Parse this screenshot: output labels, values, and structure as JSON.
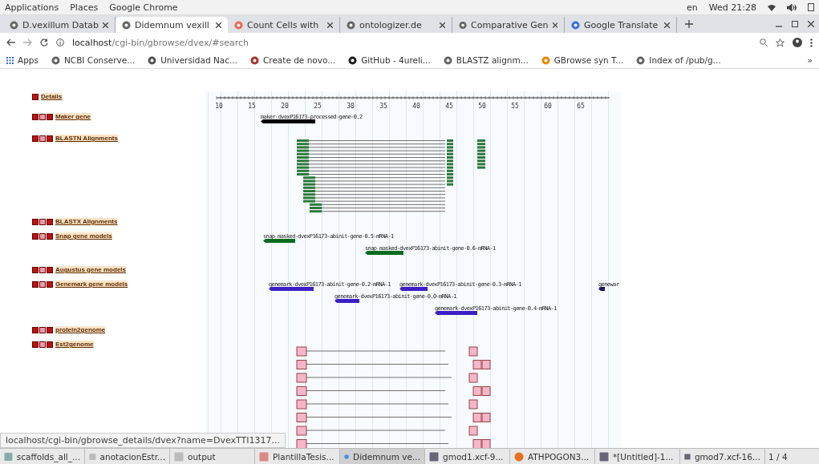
{
  "top_bar": {
    "menus": [
      "Applications",
      "Places",
      "Google Chrome"
    ],
    "language": "en",
    "clock": "Wed 21:28"
  },
  "tabs": [
    {
      "label": "D.vexillum Datab",
      "selected": false
    },
    {
      "label": "Didemnum vexill",
      "selected": true
    },
    {
      "label": "Count Cells with",
      "selected": false
    },
    {
      "label": "ontologizer.de",
      "selected": false
    },
    {
      "label": "Comparative Gen",
      "selected": false
    },
    {
      "label": "Google Translate",
      "selected": false
    }
  ],
  "address_bar": {
    "host": "localhost",
    "path": "/cgi-bin/gbrowse/dvex/#search"
  },
  "bookmarks": [
    "Apps",
    "NCBI Conserve...",
    "Universidad Nac...",
    "Create de novo...",
    "GitHub - 4ureli...",
    "BLASTZ alignm...",
    "GBrowse syn T...",
    "Index of /pub/g..."
  ],
  "bookmarks_more": "»",
  "ruler_ticks": [
    "10",
    "15",
    "20",
    "25",
    "30",
    "35",
    "40",
    "45",
    "50",
    "55",
    "60",
    "65"
  ],
  "tracks": [
    {
      "label": "Details",
      "kind": "ruler"
    },
    {
      "label": "Maker gene",
      "kind": "genes",
      "features": [
        {
          "label": "maker-dvexP16173-processed-gene-0.2",
          "color": "#000000"
        }
      ]
    },
    {
      "label": "BLASTN Alignments",
      "kind": "alignments"
    },
    {
      "label": "BLASTX Alignments",
      "kind": "empty"
    },
    {
      "label": "Snap gene models",
      "kind": "genes",
      "features": [
        {
          "label": "snap_masked-dvexP16173-abinit-gene-0.5-mRNA-1",
          "color": "#0b6b1e"
        },
        {
          "label": "snap_masked-dvexP16173-abinit-gene-0.6-mRNA-1",
          "color": "#0b6b1e"
        }
      ]
    },
    {
      "label": "Augustus gene models",
      "kind": "empty"
    },
    {
      "label": "Genemark gene models",
      "kind": "genes",
      "features": [
        {
          "label": "genemark-dvexP16173-abinit-gene-0.2-mRNA-1",
          "color": "#3b1fc4"
        },
        {
          "label": "genemark-dvexP16173-abinit-gene-0.3-mRNA-1",
          "color": "#3b1fc4"
        },
        {
          "label": "genewar",
          "color": "#1a1466"
        },
        {
          "label": "genemark-dvexP16173-abinit-gene-0.0-mRNA-1",
          "color": "#3b1fc4"
        },
        {
          "label": "genemark-dvexP16173-abinit-gene-0.4-mRNA-1",
          "color": "#3b1fc4"
        }
      ]
    },
    {
      "label": "protein2genome",
      "kind": "empty"
    },
    {
      "label": "Est2genome",
      "kind": "est"
    }
  ],
  "status_link": "localhost/cgi-bin/gbrowse_details/dvex?name=DvexTTI1317...",
  "taskbar": [
    {
      "label": "scaffolds_all_...",
      "selected": false
    },
    {
      "label": "anotacionEstr...",
      "selected": false
    },
    {
      "label": "output",
      "selected": false
    },
    {
      "label": "PlantillaTesis...",
      "selected": false
    },
    {
      "label": "Didemnum ve...",
      "selected": true
    },
    {
      "label": "gmod1.xcf-9...",
      "selected": false
    },
    {
      "label": "ATHPOGON3...",
      "selected": false
    },
    {
      "label": "*[Untitled]-1...",
      "selected": false
    },
    {
      "label": "gmod7.xcf-16...",
      "selected": false
    }
  ],
  "workspace": "1 / 4"
}
